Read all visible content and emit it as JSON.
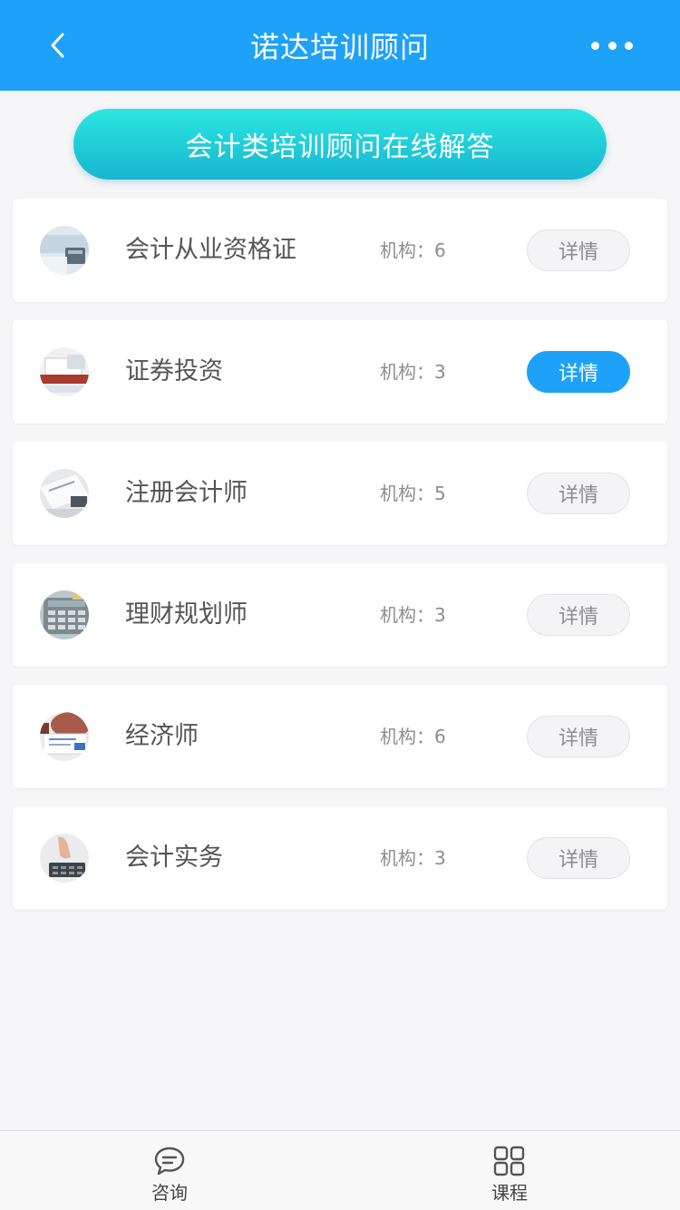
{
  "header": {
    "title": "诺达培训顾问",
    "back_icon": "chevron-left-icon",
    "more_icon": "more-dots-icon",
    "bg_color": "#1ea1f8"
  },
  "banner": {
    "label": "会计类培训顾问在线解答"
  },
  "items": [
    {
      "name": "会计从业资格证",
      "org": "机构：6",
      "detail": "详情",
      "active": false
    },
    {
      "name": "证券投资",
      "org": "机构：3",
      "detail": "详情",
      "active": true
    },
    {
      "name": "注册会计师",
      "org": "机构：5",
      "detail": "详情",
      "active": false
    },
    {
      "name": "理财规划师",
      "org": "机构：3",
      "detail": "详情",
      "active": false
    },
    {
      "name": "经济师",
      "org": "机构：6",
      "detail": "详情",
      "active": false
    },
    {
      "name": "会计实务",
      "org": "机构：3",
      "detail": "详情",
      "active": false
    }
  ],
  "tabbar": {
    "consult": {
      "label": "咨询",
      "icon": "chat-bubble-icon"
    },
    "course": {
      "label": "课程",
      "icon": "grid-icon"
    }
  }
}
